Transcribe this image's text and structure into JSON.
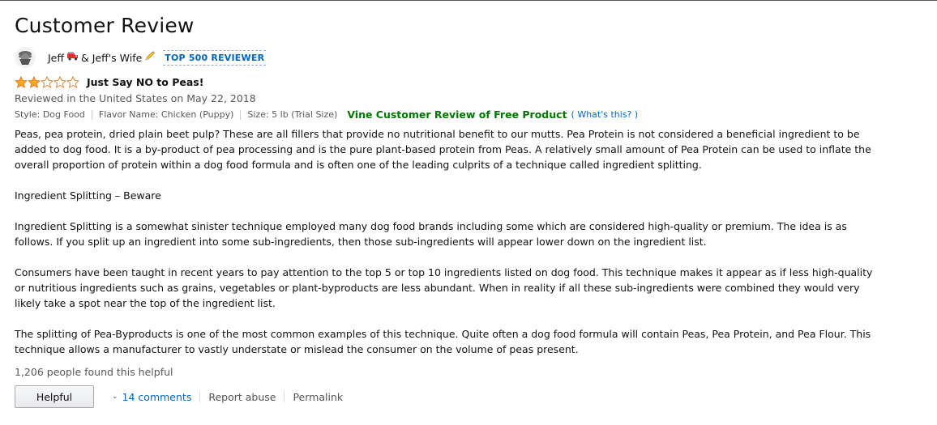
{
  "page": {
    "title": "Customer Review"
  },
  "reviewer": {
    "name": "Jeff",
    "name_suffix": "& Jeff's Wife",
    "badge": "TOP 500 REVIEWER",
    "icons": [
      "firetruck-icon",
      "pencil-icon"
    ]
  },
  "review": {
    "rating": 2,
    "max_rating": 5,
    "title": "Just Say NO to Peas!",
    "date": "Reviewed in the United States on May 22, 2018",
    "style": "Style: Dog Food",
    "flavor": "Flavor Name: Chicken (Puppy)",
    "size": "Size: 5 lb (Trial Size)",
    "vine_label": "Vine Customer Review of Free Product",
    "vine_link": "( What's this? )",
    "paragraphs": [
      "Peas, pea protein, dried plain beet pulp? These are all fillers that provide no nutritional benefit to our mutts. Pea Protein is not considered a beneficial ingredient to be added to dog food. It is a by-product of pea processing and is the pure plant-based protein from Peas. A relatively small amount of Pea Protein can be used to inflate the overall proportion of protein within a dog food formula and is often one of the leading culprits of a technique called ingredient splitting.",
      "Ingredient Splitting – Beware",
      "Ingredient Splitting is a somewhat sinister technique employed many dog food brands including some which are considered high-quality or premium. The idea is as follows. If you split up an ingredient into some sub-ingredients, then those sub-ingredients will appear lower down on the ingredient list.",
      "Consumers have been taught in recent years to pay attention to the top 5 or top 10 ingredients listed on dog food. This technique makes it appear as if less high-quality or nutritious ingredients such as grains, vegetables or plant-byproducts are less abundant. When in reality if all these sub-ingredients were combined they would very likely take a spot near the top of the ingredient list.",
      "The splitting of Pea-Byproducts is one of the most common examples of this technique. Quite often a dog food formula will contain Peas, Pea Protein, and Pea Flour. This technique allows a manufacturer to vastly understate or mislead the consumer on the volume of peas present."
    ],
    "helpful_count": "1,206 people found this helpful"
  },
  "actions": {
    "helpful_label": "Helpful",
    "comments_label": "14 comments",
    "report_label": "Report abuse",
    "permalink_label": "Permalink"
  },
  "colors": {
    "star_fill": "#f5a623",
    "star_outline": "#de7921",
    "link": "#0066c0",
    "vine": "#007600",
    "muted": "#565959"
  }
}
